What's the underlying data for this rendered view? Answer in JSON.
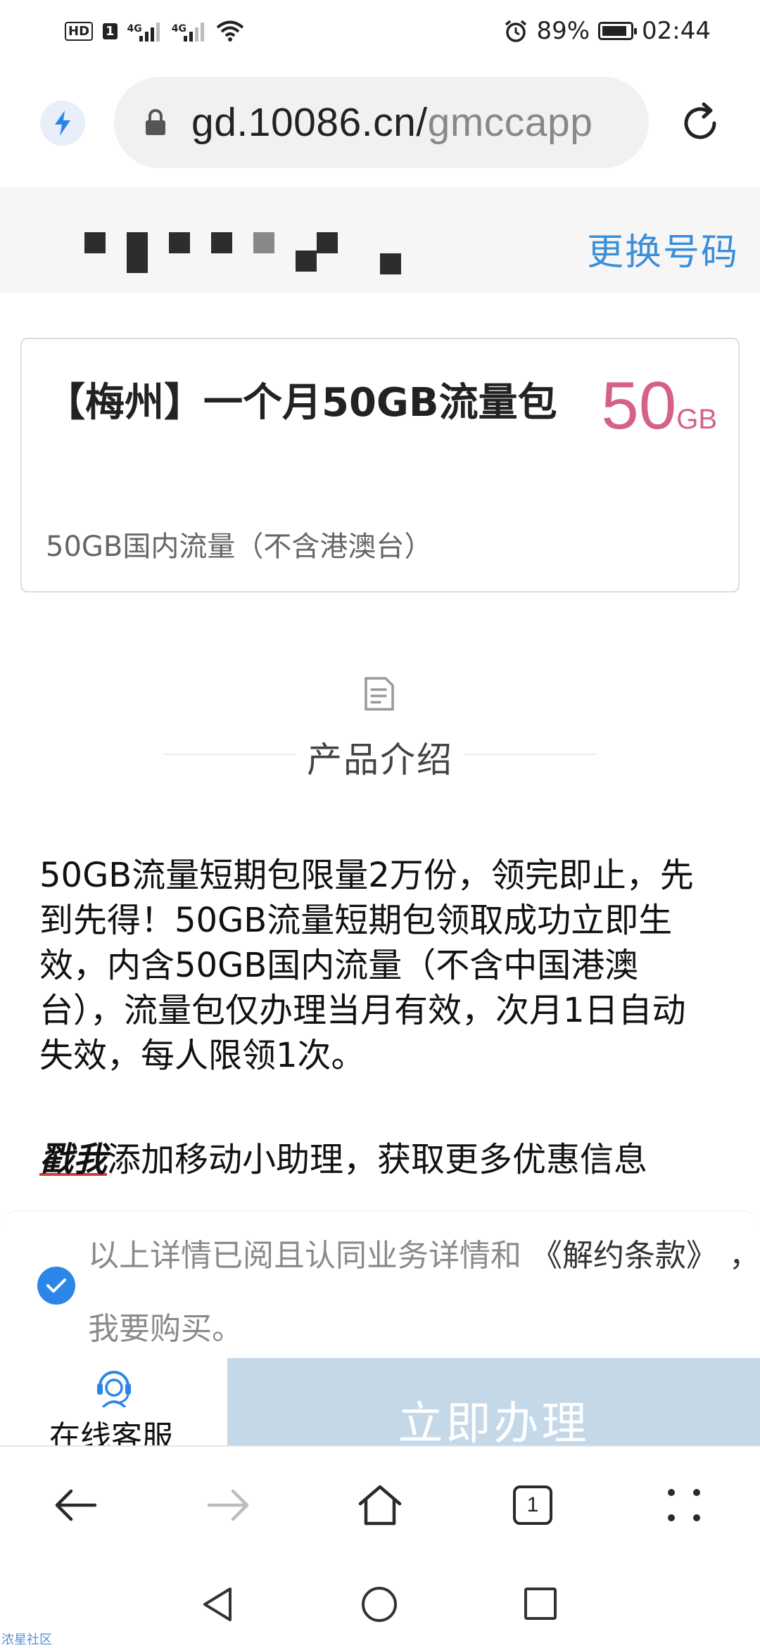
{
  "status_bar": {
    "hd_label": "HD",
    "sim_label": "1",
    "signal1_label": "4G",
    "signal2_label": "4G",
    "battery": "89%",
    "battery_level": 0.89,
    "time": "02:44"
  },
  "browser": {
    "url_host": "gd.10086.cn/",
    "url_path": "gmccapp"
  },
  "account": {
    "change_number": "更换号码"
  },
  "product": {
    "title": "【梅州】一个月50GB流量包",
    "amount": "50",
    "amount_unit": "GB",
    "subtitle": "50GB国内流量（不含港澳台）"
  },
  "intro": {
    "heading": "产品介绍",
    "body": "50GB流量短期包限量2万份，领完即止，先到先得！50GB流量短期包领取成功立即生效，内含50GB国内流量（不含中国港澳台），流量包仅办理当月有效，次月1日自动失效，每人限领1次。",
    "promo_link": "戳我",
    "promo_text": "添加移动小助理，获取更多优惠信息"
  },
  "agreement": {
    "checked": true,
    "text_before": "以上详情已阅且认同业务详情和",
    "terms_link": "《解约条款》",
    "comma": "，",
    "text_after": "我要购买。"
  },
  "actions": {
    "service_label": "在线客服",
    "apply_label": "立即办理"
  },
  "toolbar": {
    "tab_count": "1"
  },
  "watermark": "浓星社区",
  "colors": {
    "accent_blue": "#2b86e8",
    "link_blue": "#3b8fd8",
    "amount_pink": "#d4618b",
    "apply_disabled": "#c5d8e8"
  }
}
